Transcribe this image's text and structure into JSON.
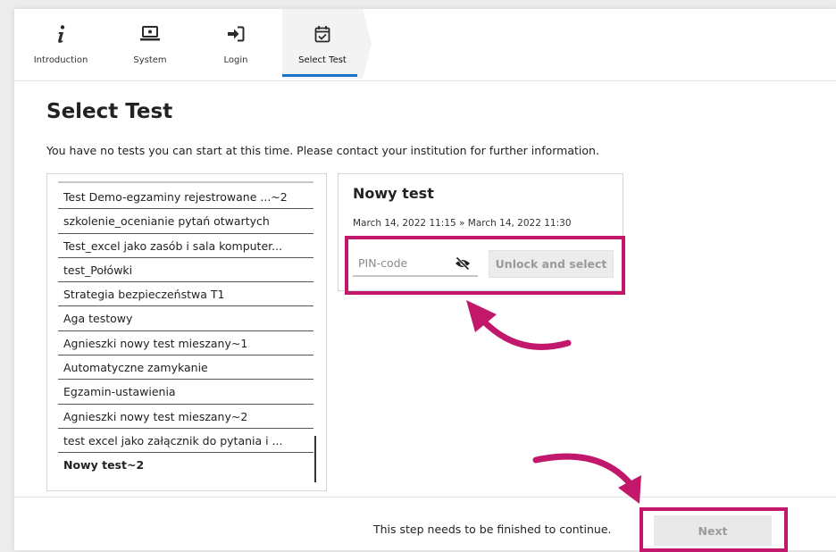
{
  "stepper": {
    "steps": [
      {
        "label": "Introduction",
        "icon": "info-icon"
      },
      {
        "label": "System",
        "icon": "computer-icon"
      },
      {
        "label": "Login",
        "icon": "login-icon"
      },
      {
        "label": "Select Test",
        "icon": "calendar-check-icon"
      }
    ],
    "active_index": 3
  },
  "page": {
    "title": "Select Test",
    "info": "You have no tests you can start at this time. Please contact your institution for further information."
  },
  "tests": [
    "Test Demo-egzaminy rejestrowane ...~2",
    "szkolenie_ocenianie pytań otwartych",
    "Test_excel jako zasób i sala komputer...",
    "test_Połówki",
    "Strategia bezpieczeństwa T1",
    "Aga testowy",
    "Agnieszki nowy test mieszany~1",
    "Automatyczne zamykanie",
    "Egzamin-ustawienia",
    "Agnieszki nowy test mieszany~2",
    "test excel jako załącznik do pytania i ...",
    "Nowy test~2"
  ],
  "detail": {
    "title": "Nowy test",
    "dates": "March 14, 2022 11:15 » March 14, 2022 11:30",
    "pin_placeholder": "PIN-code",
    "pin_value": "",
    "unlock_label": "Unlock and select"
  },
  "footer": {
    "message": "This step needs to be finished to continue.",
    "next_label": "Next"
  },
  "colors": {
    "highlight": "#c2186b",
    "accent": "#1a73c8",
    "disabled_bg": "#ececec",
    "disabled_text": "#9a9a9a"
  }
}
